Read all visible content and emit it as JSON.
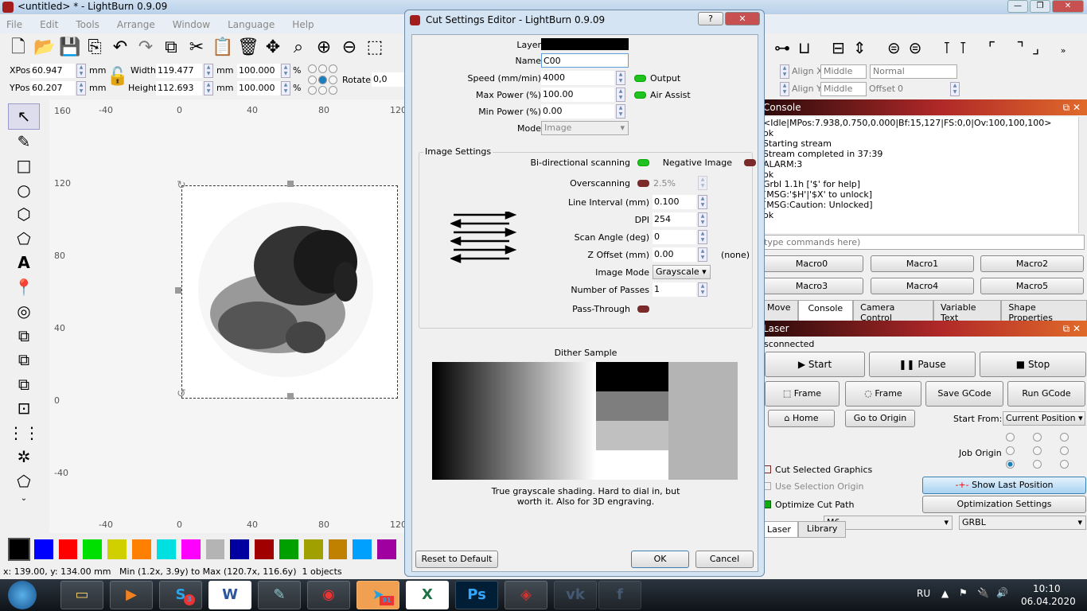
{
  "window": {
    "title": "<untitled> * - LightBurn 0.9.09",
    "buttons": [
      "—",
      "❐",
      "✕"
    ]
  },
  "menu": [
    "File",
    "Edit",
    "Tools",
    "Arrange",
    "Window",
    "Language",
    "Help"
  ],
  "toolbar_icons": [
    "new-file-icon",
    "open-folder-icon",
    "save-icon",
    "import-icon",
    "undo-icon",
    "redo-icon",
    "copy-icon",
    "cut-icon",
    "paste-icon",
    "delete-icon",
    "move-icon",
    "zoom-page-icon",
    "zoom-in-icon",
    "zoom-out-icon",
    "select-frame-icon"
  ],
  "props": {
    "xpos_label": "XPos",
    "xpos": "60.947",
    "ypos_label": "YPos",
    "ypos": "60.207",
    "unit": "mm",
    "width_label": "Width",
    "width": "119.477",
    "height_label": "Height",
    "height": "112.693",
    "scale_w": "100.000",
    "scale_h": "100.000",
    "pct": "%",
    "rotate_label": "Rotate",
    "rotate": "0,0"
  },
  "align": {
    "align_x_label": "Align X",
    "align_x": "Middle",
    "align_y_label": "Align Y",
    "align_y": "Middle",
    "font_style": "Normal",
    "offset_label": "Offset",
    "offset": "0"
  },
  "ruler": {
    "top": [
      "-40",
      "0",
      "40",
      "80",
      "120"
    ],
    "left": [
      "160",
      "120",
      "80",
      "40",
      "0",
      "-40"
    ]
  },
  "palette": [
    "#000000",
    "#0000ff",
    "#ff0000",
    "#00e000",
    "#d0d000",
    "#ff8000",
    "#00e0e0",
    "#ff00ff",
    "#b4b4b4",
    "#0000a0",
    "#a00000",
    "#00a000",
    "#a0a000",
    "#c08000",
    "#00a0ff",
    "#a000a0"
  ],
  "status": {
    "coords": "x: 139.00, y: 134.00 mm",
    "bounds": "Min (1.2x, 3.9y) to Max (120.7x, 116.6y)",
    "objects": "1 objects"
  },
  "dialog": {
    "title": "Cut Settings Editor - LightBurn 0.9.09",
    "help": "?",
    "close": "✕",
    "layer_label": "Layer",
    "layer_color": "#000000",
    "name_label": "Name",
    "name": "C00",
    "speed_label": "Speed (mm/min)",
    "speed": "4000",
    "output_label": "Output",
    "maxpower_label": "Max Power (%)",
    "maxpower": "100.00",
    "air_label": "Air Assist",
    "minpower_label": "Min Power (%)",
    "minpower": "0.00",
    "mode_label": "Mode",
    "mode": "Image",
    "image_settings": "Image Settings",
    "bidir_label": "Bi-directional scanning",
    "negative_label": "Negative Image",
    "overscan_label": "Overscanning",
    "overscan": "2.5%",
    "interval_label": "Line Interval (mm)",
    "interval": "0.100",
    "dpi_label": "DPI",
    "dpi": "254",
    "angle_label": "Scan Angle (deg)",
    "angle": "0",
    "zoffset_label": "Z Offset (mm)",
    "zoffset": "0.00",
    "zoffset_note": "(none)",
    "imgmode_label": "Image Mode",
    "imgmode": "Grayscale",
    "passes_label": "Number of Passes",
    "passes": "1",
    "passthrough_label": "Pass-Through",
    "dither_label": "Dither Sample",
    "dither_desc1": "True grayscale shading. Hard to dial in, but",
    "dither_desc2": "worth it. Also for 3D engraving.",
    "reset": "Reset to Default",
    "ok": "OK",
    "cancel": "Cancel"
  },
  "console": {
    "title": "Console",
    "lines": [
      "<Idle|MPos:7.938,0.750,0.000|Bf:15,127|FS:0,0|Ov:100,100,100>",
      "ok",
      "Starting stream",
      "Stream completed in 37:39",
      "ALARM:3",
      "ok",
      "Grbl 1.1h ['$' for help]",
      "[MSG:'$H'|'$X' to unlock]",
      "[MSG:Caution: Unlocked]",
      "ok"
    ],
    "placeholder": "type commands here)",
    "macros": [
      "Macro0",
      "Macro1",
      "Macro2",
      "Macro3",
      "Macro4",
      "Macro5"
    ],
    "tabs": [
      "Move",
      "Console",
      "Camera Control",
      "Variable Text",
      "Shape Properties"
    ]
  },
  "laser": {
    "title": "Laser",
    "state": "isconnected",
    "start": "Start",
    "pause": "Pause",
    "stop": "Stop",
    "frame1": "Frame",
    "frame2": "Frame",
    "save_gcode": "Save GCode",
    "run_gcode": "Run GCode",
    "home": "Home",
    "go_origin": "Go to Origin",
    "start_from_label": "Start From:",
    "start_from": "Current Position",
    "job_origin_label": "Job Origin",
    "cut_selected": "Cut Selected Graphics",
    "use_selection": "Use Selection Origin",
    "optimize": "Optimize Cut Path",
    "show_last": "Show Last Position",
    "opt_settings": "Optimization Settings",
    "device": "M6",
    "controller": "GRBL",
    "tabs": [
      "Laser",
      "Library"
    ]
  },
  "taskbar": {
    "skype_badge": "3",
    "telegram_badge": "91",
    "lang": "RU",
    "time": "10:10",
    "date": "06.04.2020"
  }
}
